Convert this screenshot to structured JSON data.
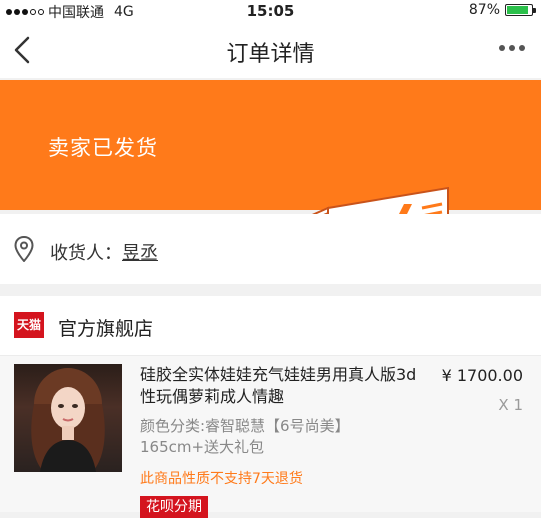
{
  "status_bar": {
    "carrier": "中国联通",
    "network": "4G",
    "time": "15:05",
    "battery": "87%",
    "battery_level": 0.87
  },
  "nav": {
    "title": "订单详情"
  },
  "banner": {
    "status_text": "卖家已发货"
  },
  "address": {
    "label": "收货人：",
    "name": "昱丞"
  },
  "shop": {
    "badge_text": "天猫",
    "name": "官方旗舰店"
  },
  "product": {
    "title": "硅胶全实体娃娃充气娃娃男用真人版3d性玩偶萝莉成人情趣",
    "price": "¥ 1700.00",
    "quantity": "X 1",
    "spec": "颜色分类:睿智聪慧【6号尚美】165cm+送大礼包",
    "notice": "此商品性质不支持7天退货",
    "tag": "花呗分期"
  },
  "colors": {
    "accent": "#ff7a1a",
    "brand_red": "#d4141e"
  }
}
